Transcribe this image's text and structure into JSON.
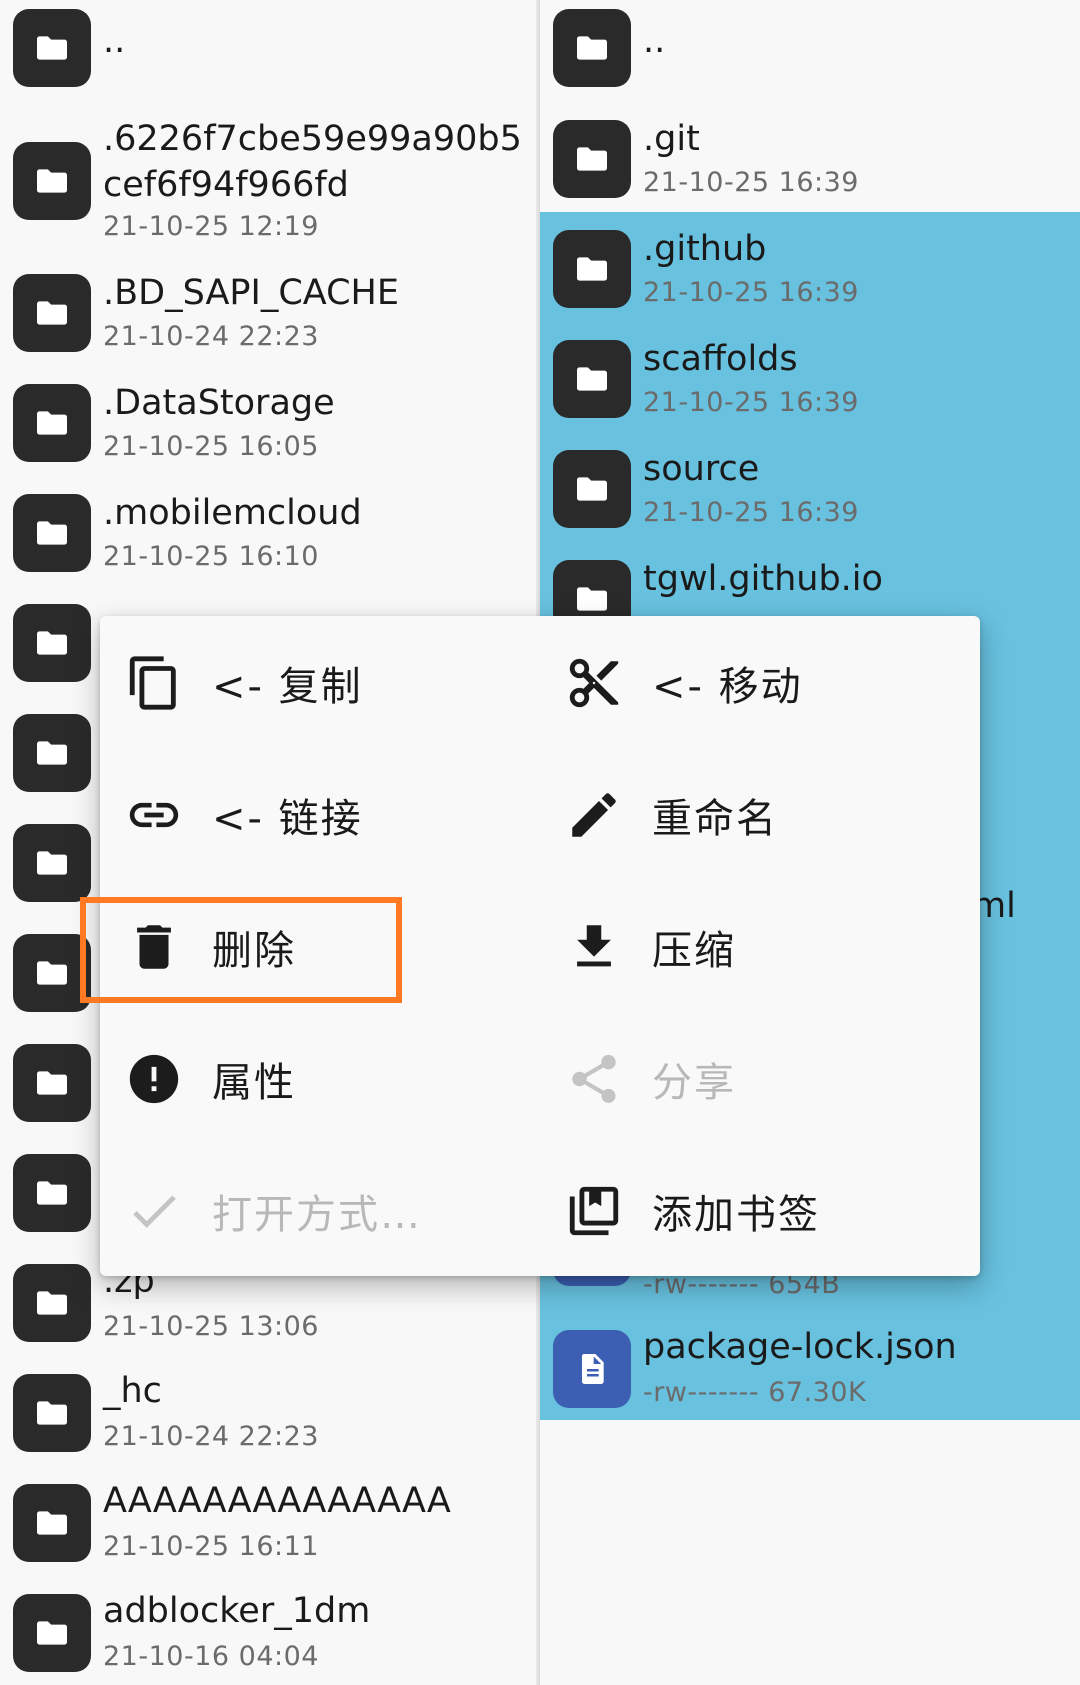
{
  "left_pane": {
    "entries": [
      {
        "name": "..",
        "meta": ""
      },
      {
        "name": ".6226f7cbe59e99a90b5cef6f94f966fd",
        "meta": "21-10-25 12:19"
      },
      {
        "name": ".BD_SAPI_CACHE",
        "meta": "21-10-24 22:23"
      },
      {
        "name": ".DataStorage",
        "meta": "21-10-25 16:05"
      },
      {
        "name": ".mobilemcloud",
        "meta": "21-10-25 16:10"
      },
      {
        "name": ".zp",
        "meta": "21-10-25 13:06"
      },
      {
        "name": "_hc",
        "meta": "21-10-24 22:23"
      },
      {
        "name": "AAAAAAAAAAAAAA",
        "meta": "21-10-25 16:11"
      },
      {
        "name": "adblocker_1dm",
        "meta": "21-10-16 04:04"
      }
    ]
  },
  "right_pane": {
    "entries": [
      {
        "name": "..",
        "meta": ""
      },
      {
        "name": ".git",
        "meta": "21-10-25 16:39"
      },
      {
        "name": ".github",
        "meta": "21-10-25 16:39"
      },
      {
        "name": "scaffolds",
        "meta": "21-10-25 16:39"
      },
      {
        "name": "source",
        "meta": "21-10-25 16:39"
      },
      {
        "name": "tgwl.github.io",
        "meta": ""
      },
      {
        "name": "package-lock.json",
        "meta": "-rw------- 67.30K"
      }
    ],
    "partial_texts": {
      "ml_fragment": "ml",
      "size_fragment": "-rw------- 654B"
    }
  },
  "context_menu": {
    "items": [
      {
        "label": "<- 复制",
        "icon": "copy-icon",
        "enabled": true
      },
      {
        "label": "<- 移动",
        "icon": "cut-icon",
        "enabled": true
      },
      {
        "label": "<- 链接",
        "icon": "link-icon",
        "enabled": true
      },
      {
        "label": "重命名",
        "icon": "pencil-icon",
        "enabled": true
      },
      {
        "label": "删除",
        "icon": "trash-icon",
        "enabled": true,
        "highlighted": true
      },
      {
        "label": "压缩",
        "icon": "download-icon",
        "enabled": true
      },
      {
        "label": "属性",
        "icon": "info-icon",
        "enabled": true
      },
      {
        "label": "分享",
        "icon": "share-icon",
        "enabled": false
      },
      {
        "label": "打开方式…",
        "icon": "check-icon",
        "enabled": false
      },
      {
        "label": "添加书签",
        "icon": "bookmark-icon",
        "enabled": true
      }
    ]
  },
  "colors": {
    "selection_bg": "#67c1df",
    "folder_icon": "#2a2a2a",
    "doc_icon": "#3c5fb4",
    "highlight_outline": "#ff7a22",
    "disabled_text": "#b8b8b8"
  }
}
